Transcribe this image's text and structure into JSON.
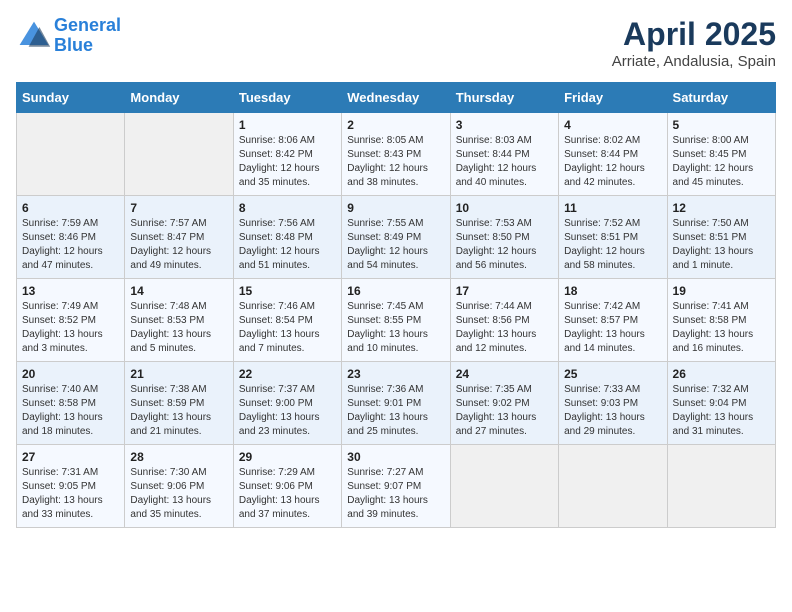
{
  "header": {
    "logo_line1": "General",
    "logo_line2": "Blue",
    "month_title": "April 2025",
    "location": "Arriate, Andalusia, Spain"
  },
  "weekdays": [
    "Sunday",
    "Monday",
    "Tuesday",
    "Wednesday",
    "Thursday",
    "Friday",
    "Saturday"
  ],
  "weeks": [
    [
      {
        "day": "",
        "sunrise": "",
        "sunset": "",
        "daylight": ""
      },
      {
        "day": "",
        "sunrise": "",
        "sunset": "",
        "daylight": ""
      },
      {
        "day": "1",
        "sunrise": "Sunrise: 8:06 AM",
        "sunset": "Sunset: 8:42 PM",
        "daylight": "Daylight: 12 hours and 35 minutes."
      },
      {
        "day": "2",
        "sunrise": "Sunrise: 8:05 AM",
        "sunset": "Sunset: 8:43 PM",
        "daylight": "Daylight: 12 hours and 38 minutes."
      },
      {
        "day": "3",
        "sunrise": "Sunrise: 8:03 AM",
        "sunset": "Sunset: 8:44 PM",
        "daylight": "Daylight: 12 hours and 40 minutes."
      },
      {
        "day": "4",
        "sunrise": "Sunrise: 8:02 AM",
        "sunset": "Sunset: 8:44 PM",
        "daylight": "Daylight: 12 hours and 42 minutes."
      },
      {
        "day": "5",
        "sunrise": "Sunrise: 8:00 AM",
        "sunset": "Sunset: 8:45 PM",
        "daylight": "Daylight: 12 hours and 45 minutes."
      }
    ],
    [
      {
        "day": "6",
        "sunrise": "Sunrise: 7:59 AM",
        "sunset": "Sunset: 8:46 PM",
        "daylight": "Daylight: 12 hours and 47 minutes."
      },
      {
        "day": "7",
        "sunrise": "Sunrise: 7:57 AM",
        "sunset": "Sunset: 8:47 PM",
        "daylight": "Daylight: 12 hours and 49 minutes."
      },
      {
        "day": "8",
        "sunrise": "Sunrise: 7:56 AM",
        "sunset": "Sunset: 8:48 PM",
        "daylight": "Daylight: 12 hours and 51 minutes."
      },
      {
        "day": "9",
        "sunrise": "Sunrise: 7:55 AM",
        "sunset": "Sunset: 8:49 PM",
        "daylight": "Daylight: 12 hours and 54 minutes."
      },
      {
        "day": "10",
        "sunrise": "Sunrise: 7:53 AM",
        "sunset": "Sunset: 8:50 PM",
        "daylight": "Daylight: 12 hours and 56 minutes."
      },
      {
        "day": "11",
        "sunrise": "Sunrise: 7:52 AM",
        "sunset": "Sunset: 8:51 PM",
        "daylight": "Daylight: 12 hours and 58 minutes."
      },
      {
        "day": "12",
        "sunrise": "Sunrise: 7:50 AM",
        "sunset": "Sunset: 8:51 PM",
        "daylight": "Daylight: 13 hours and 1 minute."
      }
    ],
    [
      {
        "day": "13",
        "sunrise": "Sunrise: 7:49 AM",
        "sunset": "Sunset: 8:52 PM",
        "daylight": "Daylight: 13 hours and 3 minutes."
      },
      {
        "day": "14",
        "sunrise": "Sunrise: 7:48 AM",
        "sunset": "Sunset: 8:53 PM",
        "daylight": "Daylight: 13 hours and 5 minutes."
      },
      {
        "day": "15",
        "sunrise": "Sunrise: 7:46 AM",
        "sunset": "Sunset: 8:54 PM",
        "daylight": "Daylight: 13 hours and 7 minutes."
      },
      {
        "day": "16",
        "sunrise": "Sunrise: 7:45 AM",
        "sunset": "Sunset: 8:55 PM",
        "daylight": "Daylight: 13 hours and 10 minutes."
      },
      {
        "day": "17",
        "sunrise": "Sunrise: 7:44 AM",
        "sunset": "Sunset: 8:56 PM",
        "daylight": "Daylight: 13 hours and 12 minutes."
      },
      {
        "day": "18",
        "sunrise": "Sunrise: 7:42 AM",
        "sunset": "Sunset: 8:57 PM",
        "daylight": "Daylight: 13 hours and 14 minutes."
      },
      {
        "day": "19",
        "sunrise": "Sunrise: 7:41 AM",
        "sunset": "Sunset: 8:58 PM",
        "daylight": "Daylight: 13 hours and 16 minutes."
      }
    ],
    [
      {
        "day": "20",
        "sunrise": "Sunrise: 7:40 AM",
        "sunset": "Sunset: 8:58 PM",
        "daylight": "Daylight: 13 hours and 18 minutes."
      },
      {
        "day": "21",
        "sunrise": "Sunrise: 7:38 AM",
        "sunset": "Sunset: 8:59 PM",
        "daylight": "Daylight: 13 hours and 21 minutes."
      },
      {
        "day": "22",
        "sunrise": "Sunrise: 7:37 AM",
        "sunset": "Sunset: 9:00 PM",
        "daylight": "Daylight: 13 hours and 23 minutes."
      },
      {
        "day": "23",
        "sunrise": "Sunrise: 7:36 AM",
        "sunset": "Sunset: 9:01 PM",
        "daylight": "Daylight: 13 hours and 25 minutes."
      },
      {
        "day": "24",
        "sunrise": "Sunrise: 7:35 AM",
        "sunset": "Sunset: 9:02 PM",
        "daylight": "Daylight: 13 hours and 27 minutes."
      },
      {
        "day": "25",
        "sunrise": "Sunrise: 7:33 AM",
        "sunset": "Sunset: 9:03 PM",
        "daylight": "Daylight: 13 hours and 29 minutes."
      },
      {
        "day": "26",
        "sunrise": "Sunrise: 7:32 AM",
        "sunset": "Sunset: 9:04 PM",
        "daylight": "Daylight: 13 hours and 31 minutes."
      }
    ],
    [
      {
        "day": "27",
        "sunrise": "Sunrise: 7:31 AM",
        "sunset": "Sunset: 9:05 PM",
        "daylight": "Daylight: 13 hours and 33 minutes."
      },
      {
        "day": "28",
        "sunrise": "Sunrise: 7:30 AM",
        "sunset": "Sunset: 9:06 PM",
        "daylight": "Daylight: 13 hours and 35 minutes."
      },
      {
        "day": "29",
        "sunrise": "Sunrise: 7:29 AM",
        "sunset": "Sunset: 9:06 PM",
        "daylight": "Daylight: 13 hours and 37 minutes."
      },
      {
        "day": "30",
        "sunrise": "Sunrise: 7:27 AM",
        "sunset": "Sunset: 9:07 PM",
        "daylight": "Daylight: 13 hours and 39 minutes."
      },
      {
        "day": "",
        "sunrise": "",
        "sunset": "",
        "daylight": ""
      },
      {
        "day": "",
        "sunrise": "",
        "sunset": "",
        "daylight": ""
      },
      {
        "day": "",
        "sunrise": "",
        "sunset": "",
        "daylight": ""
      }
    ]
  ]
}
